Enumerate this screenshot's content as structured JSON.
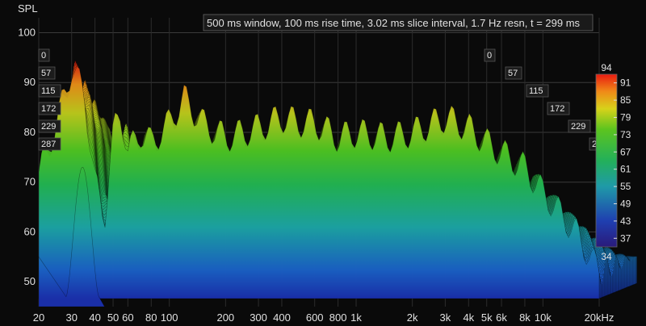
{
  "chart_data": {
    "type": "waterfall",
    "ylabel": "SPL",
    "annotation": "500 ms window, 100 ms rise time, 3.02 ms slice interval, 1.7 Hz resn, t = 299 ms",
    "y_ticks": [
      100,
      90,
      80,
      70,
      60,
      50
    ],
    "ylim": [
      45,
      103
    ],
    "x_ticks": [
      {
        "label": "20",
        "hz": 20
      },
      {
        "label": "30",
        "hz": 30
      },
      {
        "label": "40",
        "hz": 40
      },
      {
        "label": "50",
        "hz": 50
      },
      {
        "label": "60",
        "hz": 60
      },
      {
        "label": "80",
        "hz": 80
      },
      {
        "label": "100",
        "hz": 100
      },
      {
        "label": "200",
        "hz": 200
      },
      {
        "label": "300",
        "hz": 300
      },
      {
        "label": "400",
        "hz": 400
      },
      {
        "label": "600",
        "hz": 600
      },
      {
        "label": "800",
        "hz": 800
      },
      {
        "label": "1k",
        "hz": 1000
      },
      {
        "label": "2k",
        "hz": 2000
      },
      {
        "label": "3k",
        "hz": 3000
      },
      {
        "label": "4k",
        "hz": 4000
      },
      {
        "label": "5k",
        "hz": 5000
      },
      {
        "label": "6k",
        "hz": 6000
      },
      {
        "label": "8k",
        "hz": 8000
      },
      {
        "label": "10k",
        "hz": 10000
      },
      {
        "label": "20kHz",
        "hz": 20000
      }
    ],
    "xlim_hz": [
      20,
      20000
    ],
    "x_scale": "log",
    "time_ticks_ms": [
      "0",
      "57",
      "115",
      "172",
      "229",
      "287"
    ],
    "colorbar": {
      "ticks": [
        "91",
        "85",
        "79",
        "73",
        "67",
        "61",
        "55",
        "49",
        "43",
        "37"
      ],
      "max_label": "94",
      "min_label": "34",
      "range": [
        34,
        94
      ]
    },
    "series": [
      {
        "values": [
          {
            "hz": 20,
            "spl": 72
          },
          {
            "hz": 25,
            "spl": 82
          },
          {
            "hz": 30,
            "spl": 93
          },
          {
            "hz": 35,
            "spl": 88
          },
          {
            "hz": 40,
            "spl": 70
          },
          {
            "hz": 45,
            "spl": 63
          },
          {
            "hz": 50,
            "spl": 80
          },
          {
            "hz": 55,
            "spl": 84
          },
          {
            "hz": 60,
            "spl": 76
          },
          {
            "hz": 70,
            "spl": 80
          },
          {
            "hz": 80,
            "spl": 78
          },
          {
            "hz": 100,
            "spl": 82
          },
          {
            "hz": 120,
            "spl": 87
          },
          {
            "hz": 150,
            "spl": 82
          },
          {
            "hz": 200,
            "spl": 79
          },
          {
            "hz": 250,
            "spl": 80
          },
          {
            "hz": 300,
            "spl": 81
          },
          {
            "hz": 400,
            "spl": 83
          },
          {
            "hz": 500,
            "spl": 82
          },
          {
            "hz": 600,
            "spl": 82
          },
          {
            "hz": 800,
            "spl": 79
          },
          {
            "hz": 1000,
            "spl": 80
          },
          {
            "hz": 1500,
            "spl": 79
          },
          {
            "hz": 2000,
            "spl": 80
          },
          {
            "hz": 3000,
            "spl": 83
          },
          {
            "hz": 4000,
            "spl": 81
          },
          {
            "hz": 5000,
            "spl": 78
          },
          {
            "hz": 6000,
            "spl": 76
          },
          {
            "hz": 8000,
            "spl": 73
          },
          {
            "hz": 10000,
            "spl": 68
          },
          {
            "hz": 15000,
            "spl": 60
          },
          {
            "hz": 20000,
            "spl": 52
          }
        ]
      },
      {
        "values": [
          {
            "hz": 20,
            "spl": 55
          },
          {
            "hz": 25,
            "spl": 62
          },
          {
            "hz": 30,
            "spl": 74
          },
          {
            "hz": 35,
            "spl": 63
          },
          {
            "hz": 40,
            "spl": 48
          },
          {
            "hz": 50,
            "spl": 50
          },
          {
            "hz": 100,
            "spl": 50
          },
          {
            "hz": 1000,
            "spl": 50
          },
          {
            "hz": 20000,
            "spl": 48
          }
        ]
      }
    ]
  }
}
